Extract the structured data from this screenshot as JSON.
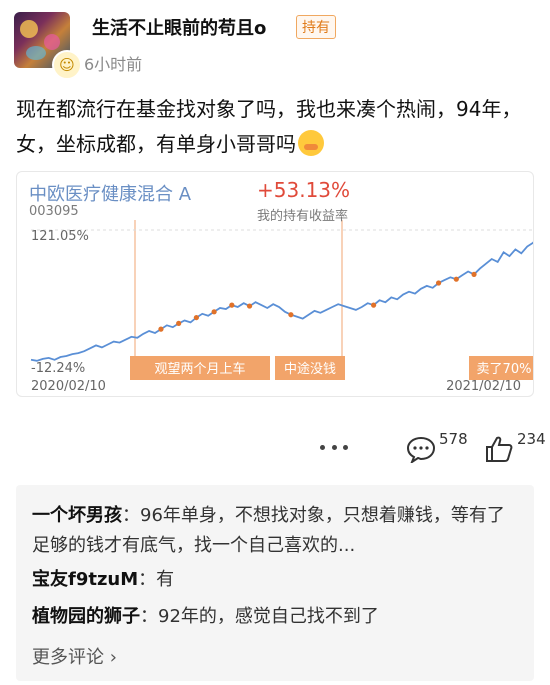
{
  "post": {
    "username": "生活不止眼前的苟且o",
    "badge": "持有",
    "time": "6小时前",
    "body": "现在都流行在基金找对象了吗，我也来凑个热闹，94年，女，坐标成都，有单身小哥哥吗"
  },
  "fund_card": {
    "name": "中欧医疗健康混合 A",
    "code": "003095",
    "return": "+53.13%",
    "return_label": "我的持有收益率"
  },
  "chart_data": {
    "type": "line",
    "ytop_label": "121.05%",
    "ybottom_label": "-12.24%",
    "ylim": [
      -12.24,
      121.05
    ],
    "x_start": "2020/02/10",
    "x_end": "2021/02/10",
    "series": [
      {
        "values": [
          -10,
          -11,
          -9,
          -8,
          -10,
          -7,
          -6,
          -4,
          -3,
          -1,
          2,
          5,
          3,
          6,
          9,
          8,
          11,
          14,
          13,
          17,
          20,
          18,
          22,
          26,
          24,
          28,
          31,
          29,
          34,
          38,
          36,
          40,
          44,
          43,
          47,
          45,
          49,
          46,
          50,
          47,
          44,
          48,
          45,
          40,
          37,
          35,
          33,
          37,
          41,
          39,
          42,
          45,
          48,
          46,
          44,
          42,
          45,
          49,
          47,
          52,
          50,
          55,
          53,
          58,
          61,
          59,
          64,
          67,
          65,
          70,
          73,
          76,
          74,
          78,
          82,
          79,
          85,
          90,
          95,
          92,
          102,
          98,
          105,
          101,
          108,
          112,
          118
        ]
      }
    ],
    "annotations": [
      "观望两个月上车",
      "中途没钱",
      "卖了70%"
    ]
  },
  "actions": {
    "comment_count": "578",
    "like_count": "234"
  },
  "comments": [
    {
      "author": "一个坏男孩",
      "sep": "：",
      "text": "96年单身，不想找对象，只想着赚钱，等有了足够的钱才有底气，找一个自己喜欢的..."
    },
    {
      "author": "宝友f9tzuM",
      "sep": "：",
      "text": "有"
    },
    {
      "author": "植物园的狮子",
      "sep": "：",
      "text": "92年的，感觉自己找不到了"
    }
  ],
  "more_comments": "更多评论 ›",
  "colors": {
    "accent": "#e04a3a",
    "line": "#5a8fd6",
    "marker": "#e0722a"
  }
}
